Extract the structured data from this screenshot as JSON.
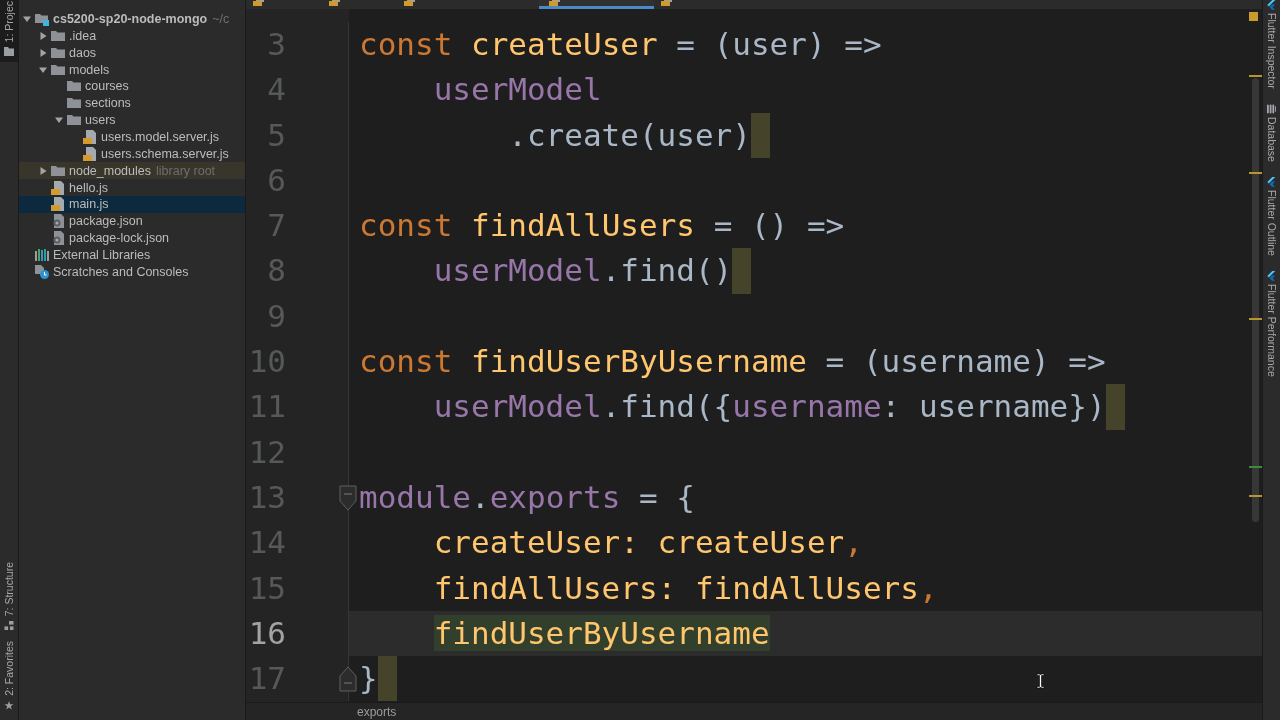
{
  "left_toolbar": {
    "top": [
      {
        "label": "1: Projec",
        "kind": "project",
        "selected": true
      }
    ],
    "bottom": [
      {
        "label": "7: Structure",
        "kind": "structure",
        "selected": false
      },
      {
        "label": "2: Favorites",
        "kind": "favorites",
        "selected": false
      }
    ]
  },
  "sidebar": {
    "tree": [
      {
        "label": "cs5200-sp20-node-mongo",
        "hint": "~/c",
        "kind": "project",
        "expanded": true,
        "selected": false,
        "children": [
          {
            "label": ".idea",
            "kind": "folder",
            "expanded": false,
            "selected": false
          },
          {
            "label": "daos",
            "kind": "folder",
            "expanded": false,
            "selected": false
          },
          {
            "label": "models",
            "kind": "folder",
            "expanded": true,
            "selected": false,
            "children": [
              {
                "label": "courses",
                "kind": "folder",
                "selected": false
              },
              {
                "label": "sections",
                "kind": "folder",
                "selected": false
              },
              {
                "label": "users",
                "kind": "folder",
                "expanded": true,
                "selected": false,
                "children": [
                  {
                    "label": "users.model.server.js",
                    "kind": "js",
                    "selected": false
                  },
                  {
                    "label": "users.schema.server.js",
                    "kind": "js",
                    "selected": false
                  }
                ]
              }
            ]
          },
          {
            "label": "node_modules",
            "hint": "library root",
            "kind": "library",
            "expanded": false,
            "selected": false
          },
          {
            "label": "hello.js",
            "kind": "js",
            "selected": false
          },
          {
            "label": "main.js",
            "kind": "js",
            "selected": true
          },
          {
            "label": "package.json",
            "kind": "json",
            "selected": false
          },
          {
            "label": "package-lock.json",
            "kind": "json",
            "selected": false
          }
        ]
      },
      {
        "label": "External Libraries",
        "kind": "libraries",
        "selected": false
      },
      {
        "label": "Scratches and Consoles",
        "kind": "scratches",
        "selected": false
      }
    ]
  },
  "editor": {
    "tabs": [
      {
        "selected": false
      },
      {
        "selected": false
      },
      {
        "selected": false
      },
      {
        "selected": true
      },
      {
        "selected": false
      }
    ],
    "lines": [
      {
        "number": "3",
        "kind": "code",
        "current": false,
        "warning": false,
        "tokens": [
          {
            "kind": "keyword",
            "text": "const"
          },
          {
            "kind": "function",
            "text": " createUser"
          },
          {
            "kind": "plain",
            "text": " = (user) =>"
          }
        ],
        "children": [
          {
            "number": "4",
            "kind": "code",
            "current": false,
            "warning": false,
            "tokens": [
              {
                "kind": "field",
                "text": "userModel"
              }
            ],
            "children": [
              {
                "number": "5",
                "kind": "code",
                "current": false,
                "warning": true,
                "tokens": [
                  {
                    "kind": "plain",
                    "text": ".create(user)"
                  }
                ]
              }
            ]
          }
        ]
      },
      {
        "number": "6",
        "kind": "blank",
        "current": false,
        "warning": false
      },
      {
        "number": "7",
        "kind": "code",
        "current": false,
        "warning": false,
        "tokens": [
          {
            "kind": "keyword",
            "text": "const"
          },
          {
            "kind": "function",
            "text": " findAllUsers"
          },
          {
            "kind": "plain",
            "text": " = () =>"
          }
        ],
        "children": [
          {
            "number": "8",
            "kind": "code",
            "current": false,
            "warning": true,
            "tokens": [
              {
                "kind": "field",
                "text": "userModel"
              },
              {
                "kind": "plain",
                "text": ".find()"
              }
            ]
          }
        ]
      },
      {
        "number": "9",
        "kind": "blank",
        "current": false,
        "warning": false
      },
      {
        "number": "10",
        "kind": "code",
        "current": false,
        "warning": false,
        "tokens": [
          {
            "kind": "keyword",
            "text": "const"
          },
          {
            "kind": "function",
            "text": " findUserByUsername"
          },
          {
            "kind": "plain",
            "text": " = (username) =>"
          }
        ],
        "children": [
          {
            "number": "11",
            "kind": "code",
            "current": false,
            "warning": true,
            "tokens": [
              {
                "kind": "field",
                "text": "userModel"
              },
              {
                "kind": "plain",
                "text": ".find({"
              },
              {
                "kind": "field",
                "text": "username"
              },
              {
                "kind": "plain",
                "text": ": username})"
              }
            ]
          }
        ]
      },
      {
        "number": "12",
        "kind": "blank",
        "current": false,
        "warning": false
      },
      {
        "number": "13",
        "kind": "fold_start",
        "current": false,
        "warning": false,
        "tokens": [
          {
            "kind": "field",
            "text": "module"
          },
          {
            "kind": "plain",
            "text": "."
          },
          {
            "kind": "field",
            "text": "exports"
          },
          {
            "kind": "plain",
            "text": " = {"
          }
        ],
        "children": [
          {
            "number": "14",
            "kind": "code",
            "current": false,
            "warning": false,
            "tokens": [
              {
                "kind": "function",
                "text": "createUser: createUser"
              },
              {
                "kind": "keyword",
                "text": ","
              }
            ]
          },
          {
            "number": "15",
            "kind": "code",
            "current": false,
            "warning": false,
            "tokens": [
              {
                "kind": "function",
                "text": "findAllUsers: findAllUsers"
              },
              {
                "kind": "keyword",
                "text": ","
              }
            ]
          },
          {
            "number": "16",
            "kind": "code",
            "current": true,
            "warning": false,
            "tokens": [
              {
                "kind": "highlighted",
                "text": "findUserByUsername"
              }
            ]
          }
        ]
      },
      {
        "number": "17",
        "kind": "fold_end",
        "current": false,
        "warning": true,
        "tokens": [
          {
            "kind": "plain",
            "text": "}"
          }
        ]
      }
    ],
    "breadcrumb": [
      "exports"
    ]
  },
  "right_toolbar": [
    {
      "label": "Flutter Inspector",
      "kind": "flutter",
      "selected": false
    },
    {
      "label": "Database",
      "kind": "database",
      "selected": false
    },
    {
      "label": "Flutter Outline",
      "kind": "flutter",
      "selected": false
    },
    {
      "label": "Flutter Performance",
      "kind": "flutter",
      "selected": false
    }
  ]
}
